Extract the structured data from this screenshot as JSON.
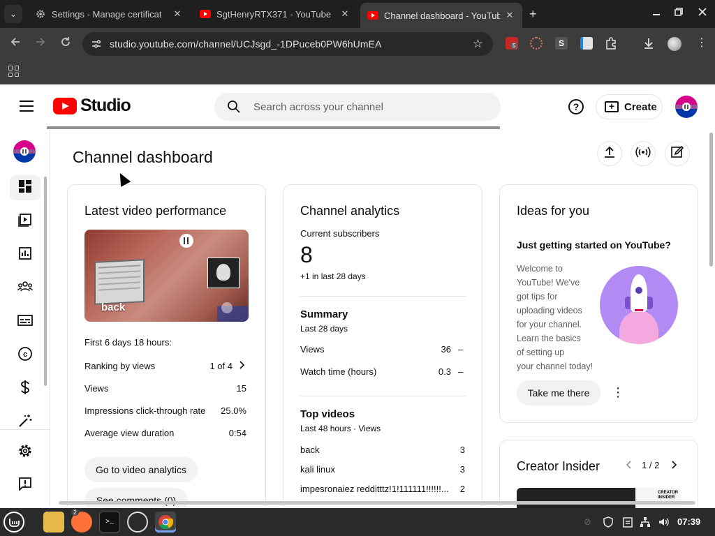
{
  "browser": {
    "tabs": [
      {
        "title": "Settings - Manage certificat",
        "icon": "gear-icon",
        "active": false
      },
      {
        "title": "SgtHenryRTX371 - YouTube",
        "icon": "youtube-icon",
        "active": false
      },
      {
        "title": "Channel dashboard - YouTub",
        "icon": "youtube-icon",
        "active": true
      }
    ],
    "url": "studio.youtube.com/channel/UCJsgd_-1DPuceb0PW6hUmEA",
    "extension_badge": "5"
  },
  "header": {
    "logo_text": "Studio",
    "search_placeholder": "Search across your channel",
    "create_label": "Create"
  },
  "page": {
    "title": "Channel dashboard"
  },
  "latest_video": {
    "title": "Latest video performance",
    "thumbnail_title": "back",
    "period": "First 6 days 18 hours:",
    "stats": [
      {
        "label": "Ranking by views",
        "value": "1 of 4"
      },
      {
        "label": "Views",
        "value": "15"
      },
      {
        "label": "Impressions click-through rate",
        "value": "25.0%"
      },
      {
        "label": "Average view duration",
        "value": "0:54"
      }
    ],
    "analytics_button": "Go to video analytics",
    "comments_button": "See comments (0)"
  },
  "analytics": {
    "title": "Channel analytics",
    "subscribers_label": "Current subscribers",
    "subscribers_value": "8",
    "subscribers_change": "+1 in last 28 days",
    "summary_title": "Summary",
    "summary_period": "Last 28 days",
    "summary_rows": [
      {
        "label": "Views",
        "value": "36",
        "trend": "–"
      },
      {
        "label": "Watch time (hours)",
        "value": "0.3",
        "trend": "–"
      }
    ],
    "top_title": "Top videos",
    "top_period": "Last 48 hours · Views",
    "top_videos": [
      {
        "title": "back",
        "views": "3"
      },
      {
        "title": "kali linux",
        "views": "3"
      },
      {
        "title": "impesronaiez redditttz!1!111111!!!!!!...",
        "views": "2"
      }
    ]
  },
  "ideas": {
    "title": "Ideas for you",
    "subtitle": "Just getting started on YouTube?",
    "body_lines": [
      "Welcome to",
      "YouTube! We've",
      "got tips for",
      "uploading videos",
      "for your channel.",
      "Learn the basics",
      "of setting up",
      "your channel today!"
    ],
    "button": "Take me there"
  },
  "creator_insider": {
    "title": "Creator Insider",
    "pager": "1 / 2",
    "thumb_badge": "CREATOR INSIDER"
  },
  "taskbar": {
    "firefox_badge": "2",
    "clock": "07:39"
  },
  "colors": {
    "brand_red": "#ff0000",
    "chrome_dark": "#3c3c3c",
    "card_border": "#e5e5e5"
  }
}
